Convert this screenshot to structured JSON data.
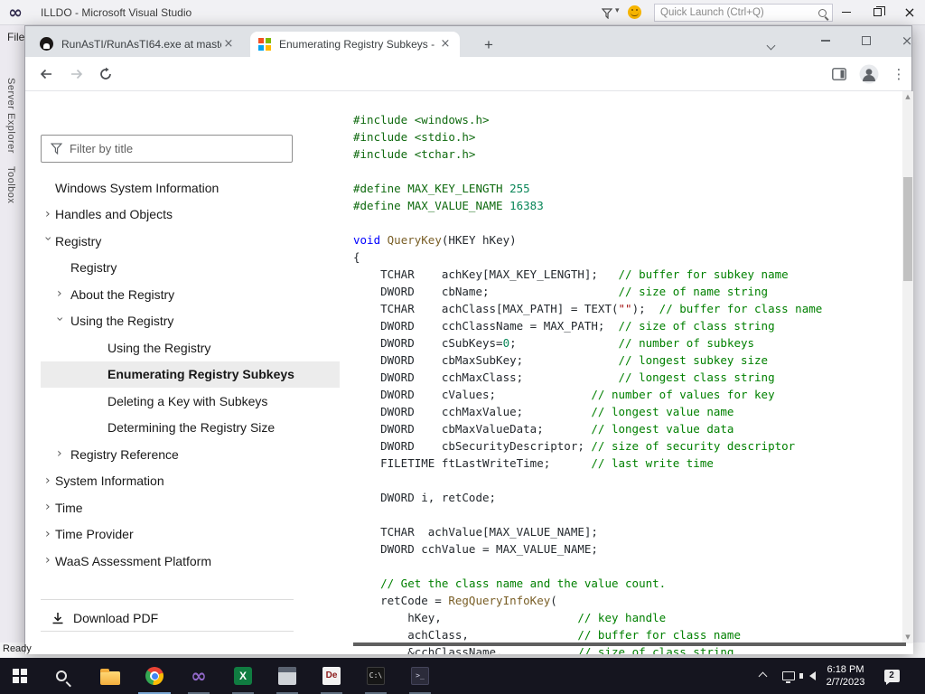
{
  "colors": {
    "comment": "#008000",
    "keyword": "#0000ff",
    "string": "#a31515",
    "number": "#098658",
    "meta": "#0f6a0f",
    "function": "#795e26",
    "code_text": "#24292e"
  },
  "vs": {
    "title": "ILLDO - Microsoft Visual Studio",
    "menu_file": "File",
    "quick_launch_placeholder": "Quick Launch (Ctrl+Q)",
    "side_tabs": [
      "Server Explorer",
      "Toolbox"
    ],
    "status": "Ready"
  },
  "browser": {
    "tabs": [
      {
        "label": "RunAsTI/RunAsTI64.exe at maste",
        "favicon": "github-icon",
        "active": false
      },
      {
        "label": "Enumerating Registry Subkeys -",
        "favicon": "microsoft-icon",
        "active": true
      }
    ],
    "url": "learn.microsoft.com/en-us/windows/win32/sysinfo/enumerating-registry-subkeys",
    "new_tab_label": "+"
  },
  "toc": {
    "filter_placeholder": "Filter by title",
    "items": [
      {
        "label": "Windows System Information",
        "level": 0,
        "chevron": "none",
        "active": false
      },
      {
        "label": "Handles and Objects",
        "level": 0,
        "chevron": "right",
        "active": false
      },
      {
        "label": "Registry",
        "level": 0,
        "chevron": "down",
        "active": false
      },
      {
        "label": "Registry",
        "level": 1,
        "chevron": "none",
        "active": false
      },
      {
        "label": "About the Registry",
        "level": 1,
        "chevron": "right",
        "active": false
      },
      {
        "label": "Using the Registry",
        "level": 1,
        "chevron": "down",
        "active": false
      },
      {
        "label": "Using the Registry",
        "level": 2,
        "chevron": "none",
        "active": false
      },
      {
        "label": "Enumerating Registry Subkeys",
        "level": 2,
        "chevron": "none",
        "active": true
      },
      {
        "label": "Deleting a Key with Subkeys",
        "level": 2,
        "chevron": "none",
        "active": false
      },
      {
        "label": "Determining the Registry Size",
        "level": 2,
        "chevron": "none",
        "active": false
      },
      {
        "label": "Registry Reference",
        "level": 1,
        "chevron": "right",
        "active": false
      },
      {
        "label": "System Information",
        "level": 0,
        "chevron": "right",
        "active": false
      },
      {
        "label": "Time",
        "level": 0,
        "chevron": "right",
        "active": false
      },
      {
        "label": "Time Provider",
        "level": 0,
        "chevron": "right",
        "active": false
      },
      {
        "label": "WaaS Assessment Platform",
        "level": 0,
        "chevron": "right",
        "active": false
      }
    ],
    "download_pdf_label": "Download PDF"
  },
  "code": {
    "language": "c",
    "lines": [
      [
        [
          "meta",
          "#include <windows.h>"
        ]
      ],
      [
        [
          "meta",
          "#include <stdio.h>"
        ]
      ],
      [
        [
          "meta",
          "#include <tchar.h>"
        ]
      ],
      [],
      [
        [
          "meta",
          "#define MAX_KEY_LENGTH "
        ],
        [
          "number",
          "255"
        ]
      ],
      [
        [
          "meta",
          "#define MAX_VALUE_NAME "
        ],
        [
          "number",
          "16383"
        ]
      ],
      [],
      [
        [
          "keyword",
          "void"
        ],
        [
          "plain",
          " "
        ],
        [
          "function",
          "QueryKey"
        ],
        [
          "plain",
          "(HKEY hKey)"
        ]
      ],
      [
        [
          "plain",
          "{"
        ]
      ],
      [
        [
          "plain",
          "    TCHAR    achKey[MAX_KEY_LENGTH];   "
        ],
        [
          "comment",
          "// buffer for subkey name"
        ]
      ],
      [
        [
          "plain",
          "    DWORD    cbName;                   "
        ],
        [
          "comment",
          "// size of name string"
        ]
      ],
      [
        [
          "plain",
          "    TCHAR    achClass[MAX_PATH] = TEXT("
        ],
        [
          "string",
          "\"\""
        ],
        [
          "plain",
          ");  "
        ],
        [
          "comment",
          "// buffer for class name"
        ]
      ],
      [
        [
          "plain",
          "    DWORD    cchClassName = MAX_PATH;  "
        ],
        [
          "comment",
          "// size of class string"
        ]
      ],
      [
        [
          "plain",
          "    DWORD    cSubKeys="
        ],
        [
          "number",
          "0"
        ],
        [
          "plain",
          ";               "
        ],
        [
          "comment",
          "// number of subkeys"
        ]
      ],
      [
        [
          "plain",
          "    DWORD    cbMaxSubKey;              "
        ],
        [
          "comment",
          "// longest subkey size"
        ]
      ],
      [
        [
          "plain",
          "    DWORD    cchMaxClass;              "
        ],
        [
          "comment",
          "// longest class string"
        ]
      ],
      [
        [
          "plain",
          "    DWORD    cValues;              "
        ],
        [
          "comment",
          "// number of values for key"
        ]
      ],
      [
        [
          "plain",
          "    DWORD    cchMaxValue;          "
        ],
        [
          "comment",
          "// longest value name"
        ]
      ],
      [
        [
          "plain",
          "    DWORD    cbMaxValueData;       "
        ],
        [
          "comment",
          "// longest value data"
        ]
      ],
      [
        [
          "plain",
          "    DWORD    cbSecurityDescriptor; "
        ],
        [
          "comment",
          "// size of security descriptor"
        ]
      ],
      [
        [
          "plain",
          "    FILETIME ftLastWriteTime;      "
        ],
        [
          "comment",
          "// last write time"
        ]
      ],
      [],
      [
        [
          "plain",
          "    DWORD i, retCode;"
        ]
      ],
      [],
      [
        [
          "plain",
          "    TCHAR  achValue[MAX_VALUE_NAME];"
        ]
      ],
      [
        [
          "plain",
          "    DWORD cchValue = MAX_VALUE_NAME;"
        ]
      ],
      [],
      [
        [
          "plain",
          "    "
        ],
        [
          "comment",
          "// Get the class name and the value count."
        ]
      ],
      [
        [
          "plain",
          "    retCode = "
        ],
        [
          "function",
          "RegQueryInfoKey"
        ],
        [
          "plain",
          "("
        ]
      ],
      [
        [
          "plain",
          "        hKey,                    "
        ],
        [
          "comment",
          "// key handle"
        ]
      ],
      [
        [
          "plain",
          "        achClass,                "
        ],
        [
          "comment",
          "// buffer for class name"
        ]
      ],
      [
        [
          "plain",
          "        &cchClassName,           "
        ],
        [
          "comment",
          "// size of class string"
        ]
      ]
    ]
  },
  "taskbar": {
    "time": "6:18 PM",
    "date": "2/7/2023",
    "notification_count": "2",
    "excel_letter": "X",
    "de_badge": "De",
    "cmd_glyph": "C:\\",
    "term_glyph": ">_"
  }
}
